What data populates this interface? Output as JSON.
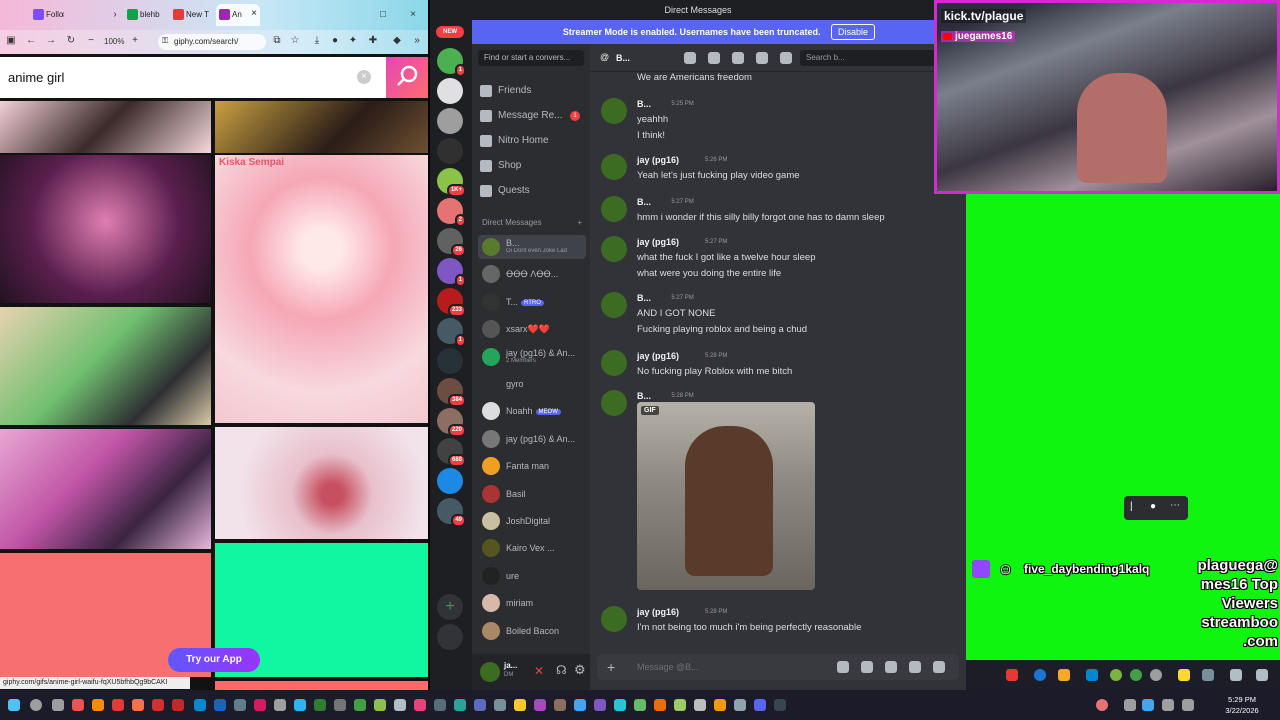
{
  "browser": {
    "tabs": [
      {
        "label": "Follo",
        "color": "#7c4dff"
      },
      {
        "label": "blehb",
        "color": "#12a14b"
      },
      {
        "label": "New T",
        "color": "#e03c3c"
      },
      {
        "label": "An",
        "color": "#9c27b0"
      }
    ],
    "zoom": "100%",
    "url": "giphy.com/search/",
    "search_query": "anime girl",
    "status_url": "giphy.com/gifs/anime-girl-waifu-fqXU5bfhbQg9bCAKI",
    "try_app_label": "Try our App",
    "gif_caption": "Kiska Sempai"
  },
  "discord": {
    "window_title": "Direct Messages",
    "new_badge": "NEW",
    "streamer_banner": "Streamer Mode is enabled. Usernames have been truncated.",
    "disable_label": "Disable",
    "find_placeholder": "Find or start a convers...",
    "nav": [
      {
        "label": "Friends"
      },
      {
        "label": "Message Re...",
        "badge": "1"
      },
      {
        "label": "Nitro Home"
      },
      {
        "label": "Shop"
      },
      {
        "label": "Quests"
      }
    ],
    "dm_header": "Direct Messages",
    "dms": [
      {
        "name": "B...",
        "sub": "Oi Dont even Joke Lad",
        "color": "#5a7a2e",
        "selected": true
      },
      {
        "name": "ꝊꝊꝊ ΛꝊꝊ...",
        "sub": "",
        "color": "#666"
      },
      {
        "name": "T...",
        "tag": "RTRO",
        "color": "#333"
      },
      {
        "name": "xsarx❤️❤️",
        "sub": "",
        "color": "#555"
      },
      {
        "name": "jay (pg16) & An...",
        "sub": "2 Members",
        "color": "#23a55a"
      },
      {
        "name": "gyro",
        "sub": "",
        "color": "#2b2d31"
      },
      {
        "name": "Noahh",
        "tag": "MEOW",
        "color": "#ddd"
      },
      {
        "name": "jay (pg16) & An...",
        "sub": "",
        "color": "#777"
      },
      {
        "name": "Fanta man",
        "sub": "",
        "color": "#f0a020"
      },
      {
        "name": "Basil",
        "sub": "",
        "color": "#a33"
      },
      {
        "name": "JoshDigital",
        "sub": "",
        "color": "#c8c0a0"
      },
      {
        "name": "Kairo Vex ...",
        "sub": "",
        "color": "#552"
      },
      {
        "name": "ure",
        "sub": "",
        "color": "#222"
      },
      {
        "name": "miriam",
        "sub": "",
        "color": "#d8b8a8"
      },
      {
        "name": "Boiled Bacon",
        "sub": "",
        "color": "#a86"
      }
    ],
    "guild_badges": [
      "1",
      "",
      "",
      "",
      "1K+",
      "2",
      "26",
      "1",
      "233",
      "1",
      "",
      "384",
      "220",
      "688",
      "",
      "49"
    ],
    "user": {
      "name": "ja...",
      "status": "DM"
    },
    "chat_header": "B...",
    "chat_search": "Search b...",
    "messages": [
      {
        "name": "",
        "time": "",
        "lines": [
          "We are Americans freedom"
        ]
      },
      {
        "name": "B...",
        "time": "5:25 PM",
        "lines": [
          "yeahhh",
          "I think!"
        ]
      },
      {
        "name": "jay (pg16)",
        "time": "5:26 PM",
        "lines": [
          "Yeah let's just fucking play video game"
        ]
      },
      {
        "name": "B...",
        "time": "5:27 PM",
        "lines": [
          "hmm i wonder if this silly billy forgot one has to damn sleep"
        ]
      },
      {
        "name": "jay (pg16)",
        "time": "5:27 PM",
        "lines": [
          "what the fuck I got like a twelve hour sleep",
          "what were you doing the entire life"
        ]
      },
      {
        "name": "B...",
        "time": "5:27 PM",
        "lines": [
          "AND I GOT NONE",
          "Fucking playing roblox and being a chud"
        ]
      },
      {
        "name": "jay (pg16)",
        "time": "5:28 PM",
        "lines": [
          "No fucking play Roblox with me bitch"
        ]
      },
      {
        "name": "B...",
        "time": "5:28 PM",
        "lines": []
      },
      {
        "name": "jay (pg16)",
        "time": "5:28 PM",
        "lines": [
          "I'm not being too much i'm being perfectly reasonable"
        ]
      }
    ],
    "gif_label": "GIF",
    "composer_placeholder": "Message @B..."
  },
  "stream": {
    "kick_label": "kick.tv/plague",
    "yt_label": "juegames16",
    "viewer_name": "five_daybending1kalq",
    "top_viewers": [
      "plaguega@",
      "mes16 Top",
      "Viewers",
      "streamboo",
      ".com"
    ]
  },
  "taskbar": {
    "time": "5:29 PM",
    "date": "3/22/2026"
  }
}
